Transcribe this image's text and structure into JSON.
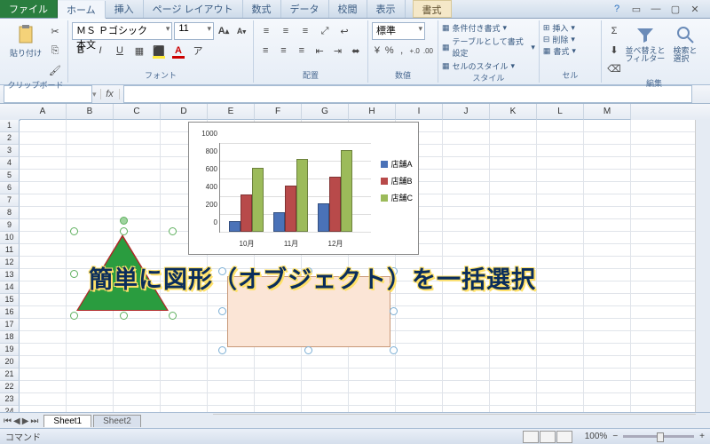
{
  "tabs": {
    "file": "ファイル",
    "items": [
      "ホーム",
      "挿入",
      "ページ レイアウト",
      "数式",
      "データ",
      "校閲",
      "表示"
    ],
    "context": "書式",
    "active": 0
  },
  "ribbon": {
    "clipboard": {
      "label": "クリップボード",
      "paste": "貼り付け"
    },
    "font": {
      "label": "フォント",
      "name": "ＭＳ Ｐゴシック 本文",
      "size": "11",
      "bold": "B",
      "italic": "I",
      "underline": "U",
      "grow": "A",
      "shrink": "A"
    },
    "align": {
      "label": "配置",
      "std": "標準"
    },
    "number": {
      "label": "数値",
      "inc": "+.0",
      "dec": ".00"
    },
    "styles": {
      "label": "スタイル",
      "cond": "条件付き書式",
      "table": "テーブルとして書式設定",
      "cell": "セルのスタイル"
    },
    "cells": {
      "label": "セル",
      "insert": "挿入",
      "delete": "削除",
      "format": "書式"
    },
    "edit": {
      "label": "編集",
      "sort": "並べ替えと\nフィルター",
      "find": "検索と\n選択"
    }
  },
  "formula_bar": {
    "name": "",
    "fx": "fx"
  },
  "grid": {
    "columns": [
      "A",
      "B",
      "C",
      "D",
      "E",
      "F",
      "G",
      "H",
      "I",
      "J",
      "K",
      "L",
      "M"
    ],
    "rows": 25
  },
  "chart_data": {
    "type": "bar",
    "categories": [
      "10月",
      "11月",
      "12月"
    ],
    "series": [
      {
        "name": "店舗A",
        "values": [
          100,
          200,
          300
        ],
        "color": "#4a72b8"
      },
      {
        "name": "店舗B",
        "values": [
          400,
          500,
          600
        ],
        "color": "#b84a4a"
      },
      {
        "name": "店舗C",
        "values": [
          700,
          800,
          900
        ],
        "color": "#9cbb5a"
      }
    ],
    "ylim": [
      0,
      1000
    ],
    "yticks": [
      0,
      200,
      400,
      600,
      800,
      1000
    ]
  },
  "overlay": {
    "text": "簡単に図形（オブジェクト）を一括選択"
  },
  "sheet_tabs": {
    "tabs": [
      "Sheet1",
      "Sheet2"
    ],
    "active": 0
  },
  "status": {
    "mode": "コマンド",
    "zoom": "100%"
  }
}
